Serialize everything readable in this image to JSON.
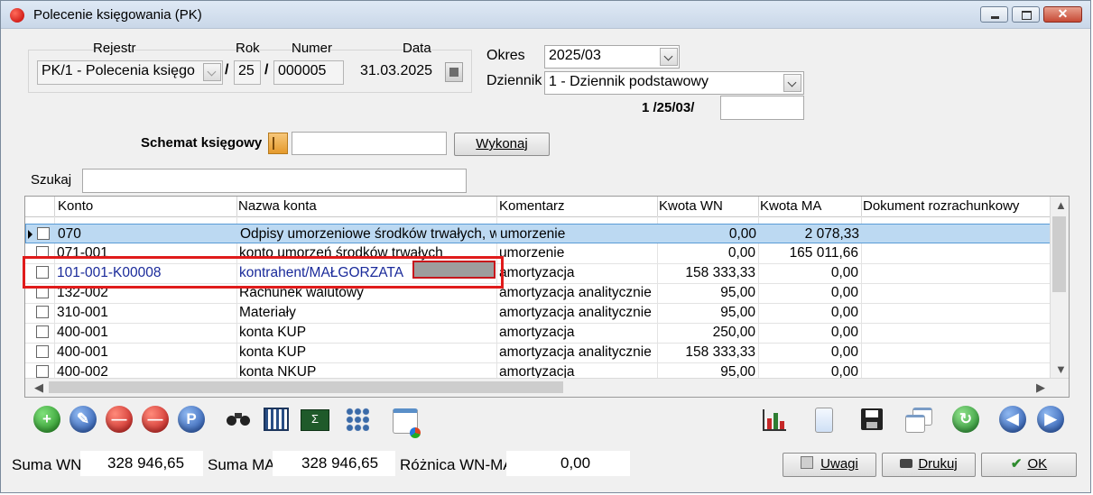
{
  "window": {
    "title": "Polecenie księgowania (PK)"
  },
  "header": {
    "rejestr_label": "Rejestr",
    "rejestr_value": "PK/1  - Polecenia księgo",
    "rok_label": "Rok",
    "rok_value": "25",
    "numer_label": "Numer",
    "numer_value": "000005",
    "data_label": "Data",
    "data_value": "31.03.2025",
    "slash": "/",
    "okres_label": "Okres",
    "okres_value": "2025/03",
    "dziennik_label": "Dziennik",
    "dziennik_value": "1  - Dziennik podstawowy",
    "doc_number": "1 /25/03/",
    "doc_extra": ""
  },
  "schemat": {
    "label": "Schemat księgowy",
    "value": "",
    "run_button": "Wykonaj"
  },
  "search": {
    "label": "Szukaj",
    "value": ""
  },
  "table": {
    "columns": [
      "Konto",
      "Nazwa konta",
      "Komentarz",
      "Kwota WN",
      "Kwota MA",
      "Dokument rozrachunkowy"
    ],
    "rows": [
      {
        "konto": "070",
        "nazwa": "Odpisy umorzeniowe środków trwałych, wart.",
        "komentarz": "umorzenie",
        "wn": "0,00",
        "ma": "2 078,33",
        "dok": ""
      },
      {
        "konto": "071-001",
        "nazwa": "konto umorzeń środków trwałych",
        "komentarz": "umorzenie",
        "wn": "0,00",
        "ma": "165 011,66",
        "dok": ""
      },
      {
        "konto": "101-001-K00008",
        "nazwa": "kontrahent/MAŁGORZATA",
        "komentarz": "amortyzacja",
        "wn": "158 333,33",
        "ma": "0,00",
        "dok": ""
      },
      {
        "konto": "132-002",
        "nazwa": "Rachunek walutowy",
        "komentarz": "amortyzacja analitycznie",
        "wn": "95,00",
        "ma": "0,00",
        "dok": ""
      },
      {
        "konto": "310-001",
        "nazwa": "Materiały",
        "komentarz": "amortyzacja analitycznie",
        "wn": "95,00",
        "ma": "0,00",
        "dok": ""
      },
      {
        "konto": "400-001",
        "nazwa": "konta KUP",
        "komentarz": "amortyzacja",
        "wn": "250,00",
        "ma": "0,00",
        "dok": ""
      },
      {
        "konto": "400-001",
        "nazwa": "konta KUP",
        "komentarz": "amortyzacja analitycznie",
        "wn": "158 333,33",
        "ma": "0,00",
        "dok": ""
      },
      {
        "konto": "400-002",
        "nazwa": "konta NKUP",
        "komentarz": "amortyzacja",
        "wn": "95,00",
        "ma": "0,00",
        "dok": ""
      }
    ]
  },
  "toolbar": {
    "icons": [
      "add-icon",
      "edit-icon",
      "delete-icon",
      "delete-checked-icon",
      "parking-icon",
      "binoculars-icon",
      "calculator-grid-icon",
      "sum-icon",
      "hierarchy-icon",
      "chart-window-icon",
      "bar-chart-icon",
      "document-icon",
      "save-icon",
      "copy-windows-icon",
      "refresh-icon",
      "previous-icon",
      "next-icon"
    ],
    "parking_glyph": "P"
  },
  "footer": {
    "suma_wn_label": "Suma WN",
    "suma_wn_value": "328 946,65",
    "suma_ma_label": "Suma MA",
    "suma_ma_value": "328 946,65",
    "roznica_label": "Różnica WN-MA",
    "roznica_value": "0,00",
    "uwagi_button": "Uwagi",
    "drukuj_button": "Drukuj",
    "ok_button": "OK"
  },
  "colors": {
    "selected_row": "#bcd9f2",
    "highlight_box": "#e01b1b",
    "account_link": "#1a2a9a"
  }
}
